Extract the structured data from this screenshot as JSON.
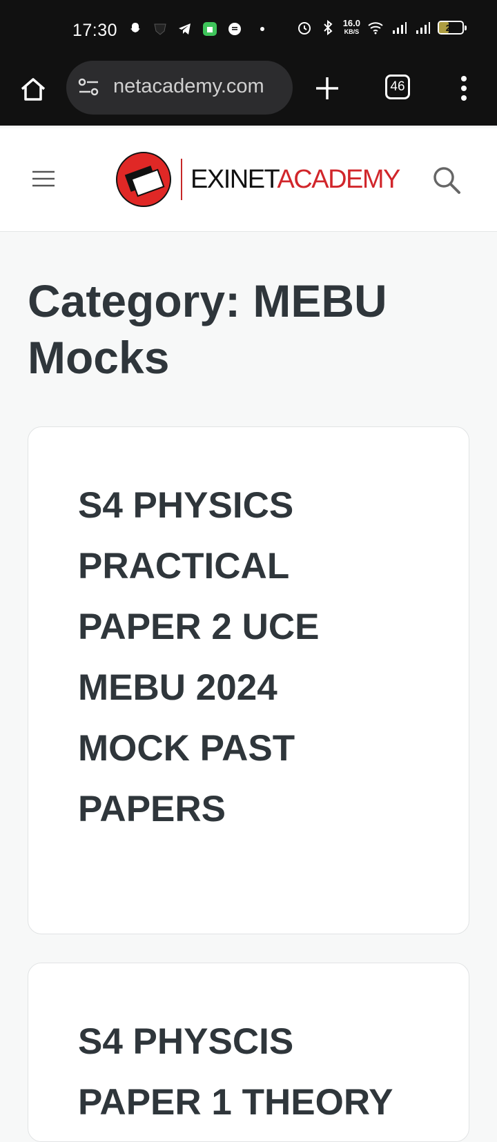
{
  "status_bar": {
    "time": "17:30",
    "net_speed_value": "16.0",
    "net_speed_unit": "KB/S",
    "battery_level": "25",
    "icons_left": [
      "snapchat-icon",
      "shield-icon",
      "telegram-icon",
      "store-icon",
      "chat-icon",
      "dot-icon"
    ],
    "icons_right": [
      "alarm-icon",
      "bluetooth-icon",
      "wifi-icon",
      "signal-icon",
      "signal-icon"
    ]
  },
  "browser": {
    "url": "netacademy.com",
    "tab_count": "46"
  },
  "site": {
    "logo_word1": "EXINET",
    "logo_word2": "ACADEMY",
    "brand_color": "#d1262b"
  },
  "archive": {
    "title": "Category: MEBU Mocks"
  },
  "posts": [
    {
      "title": "S4 PHYSICS PRACTICAL PAPER 2 UCE MEBU 2024 MOCK PAST PAPERS"
    },
    {
      "title": "S4 PHYSCIS PAPER 1 THEORY"
    }
  ]
}
